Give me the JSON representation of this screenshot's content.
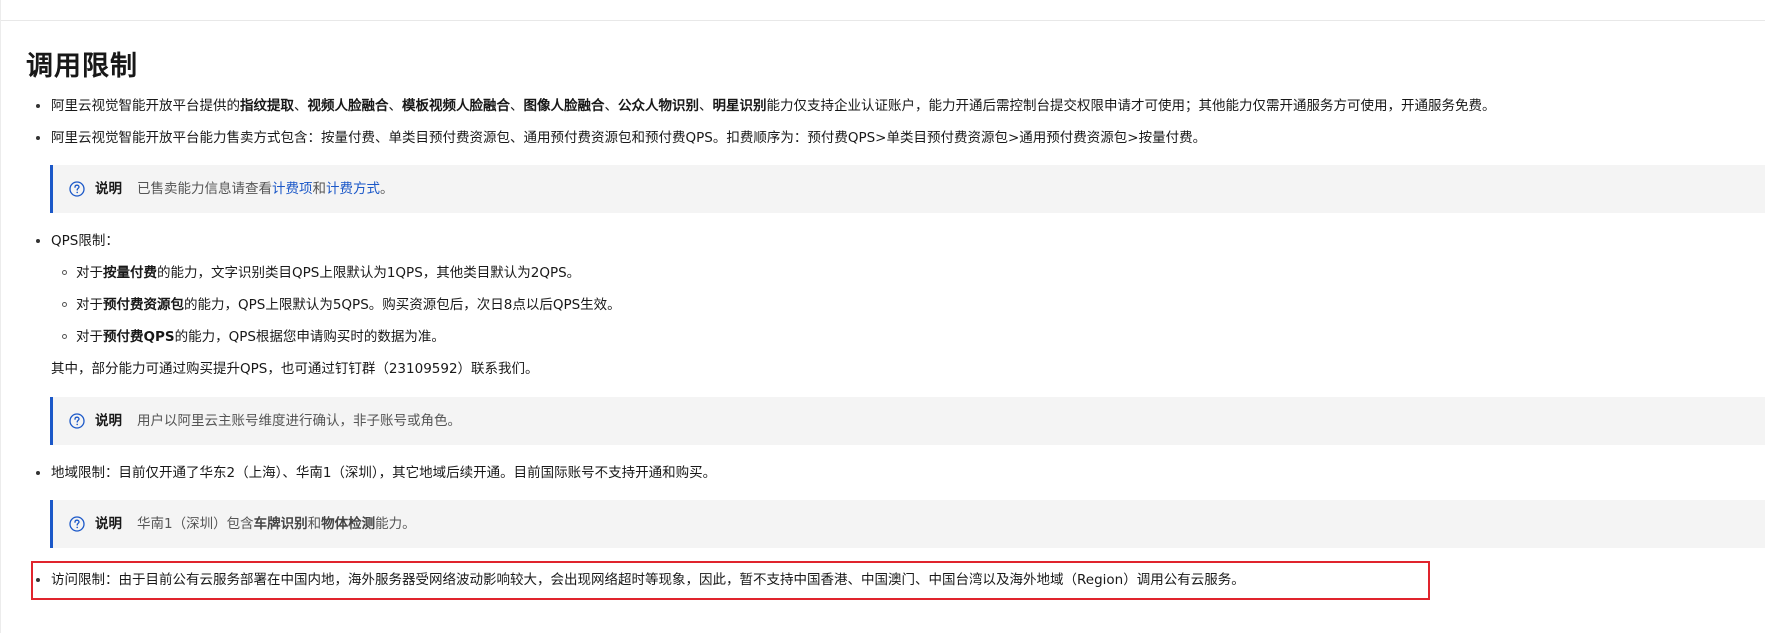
{
  "heading": "调用限制",
  "item1": {
    "t1": "阿里云视觉智能开放平台提供的",
    "b1": "指纹提取",
    "s1": "、",
    "b2": "视频人脸融合",
    "s2": "、",
    "b3": "模板视频人脸融合",
    "s3": "、",
    "b4": "图像人脸融合",
    "s4": "、",
    "b5": "公众人物识别",
    "s5": "、",
    "b6": "明星识别",
    "t2": "能力仅支持企业认证账户，能力开通后需控制台提交权限申请才可使用；其他能力仅需开通服务方可使用，开通服务免费。"
  },
  "item2": "阿里云视觉智能开放平台能力售卖方式包含：按量付费、单类目预付费资源包、通用预付费资源包和预付费QPS。扣费顺序为：预付费QPS>单类目预付费资源包>通用预付费资源包>按量付费。",
  "note1": {
    "label": "说明",
    "t1": "已售卖能力信息请查看",
    "link1": "计费项",
    "t2": "和",
    "link2": "计费方式",
    "t3": "。"
  },
  "item3": "QPS限制：",
  "sub1": {
    "t1": "对于",
    "b": "按量付费",
    "t2": "的能力，文字识别类目QPS上限默认为1QPS，其他类目默认为2QPS。"
  },
  "sub2": {
    "t1": "对于",
    "b": "预付费资源包",
    "t2": "的能力，QPS上限默认为5QPS。购买资源包后，次日8点以后QPS生效。"
  },
  "sub3": {
    "t1": "对于",
    "b": "预付费QPS",
    "t2": "的能力，QPS根据您申请购买时的数据为准。"
  },
  "plain1": "其中，部分能力可通过购买提升QPS，也可通过钉钉群（23109592）联系我们。",
  "note2": {
    "label": "说明",
    "text": "用户以阿里云主账号维度进行确认，非子账号或角色。"
  },
  "item4": "地域限制：目前仅开通了华东2（上海）、华南1（深圳），其它地域后续开通。目前国际账号不支持开通和购买。",
  "note3": {
    "label": "说明",
    "t1": "华南1（深圳）包含",
    "b1": "车牌识别",
    "t2": "和",
    "b2": "物体检测",
    "t3": "能力。"
  },
  "item5": "访问限制：由于目前公有云服务部署在中国内地，海外服务器受网络波动影响较大，会出现网络超时等现象，因此，暂不支持中国香港、中国澳门、中国台湾以及海外地域（Region）调用公有云服务。",
  "colors": {
    "accent": "#1b58c8",
    "highlight": "#e0242d",
    "note_bg": "#f4f4f4"
  },
  "icons": {
    "note": "question-circle-icon"
  }
}
